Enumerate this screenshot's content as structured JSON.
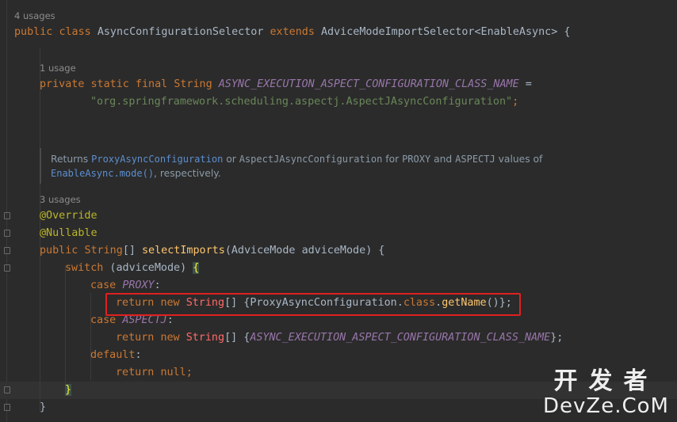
{
  "hints": {
    "usages_4": "4 usages",
    "usages_1": "1 usage",
    "usages_3": "3 usages"
  },
  "code": {
    "class_decl": {
      "public": "public",
      "class_kw": "class",
      "class_name": "AsyncConfigurationSelector",
      "extends": "extends",
      "super_name": "AdviceModeImportSelector",
      "generic_open": "<",
      "generic_type": "EnableAsync",
      "generic_close": ">",
      "brace": " {"
    },
    "field_decl": {
      "modifiers": "private static final",
      "type": "String",
      "name": "ASYNC_EXECUTION_ASPECT_CONFIGURATION_CLASS_NAME",
      "eq": " ="
    },
    "field_value": "\"org.springframework.scheduling.aspectj.AspectJAsyncConfiguration\"",
    "field_end": ";",
    "doc": {
      "line1_a": "Returns ",
      "line1_link1": "ProxyAsyncConfiguration",
      "line1_b": " or ",
      "line1_code1": "AspectJAsyncConfiguration",
      "line1_c": " for ",
      "line1_code2": "PROXY",
      "line1_d": " and ",
      "line1_code3": "ASPECTJ",
      "line1_e": " values of",
      "line2_link": "EnableAsync.mode()",
      "line2_rest": ", respectively."
    },
    "ann_override": "@Override",
    "ann_nullable": "@Nullable",
    "method_decl": {
      "public": "public",
      "ret_type": "String",
      "arr": "[] ",
      "name": "selectImports",
      "paren_open": "(",
      "param_type": "AdviceMode",
      "param_name": "adviceMode",
      "paren_close": ") {"
    },
    "switch_line": {
      "kw": "switch",
      "open": " (",
      "var": "adviceMode",
      "close": ") ",
      "brace": "{"
    },
    "case_proxy": {
      "kw": "case",
      "val": "PROXY",
      "colon": ":"
    },
    "return_proxy": {
      "ret": "return",
      "new_kw": "new",
      "type": "String",
      "arr": "[] {",
      "cls": "ProxyAsyncConfiguration",
      "dot1": ".",
      "class_kw": "class",
      "dot2": ".",
      "method": "getName",
      "end": "()};"
    },
    "case_aspectj": {
      "kw": "case",
      "val": "ASPECTJ",
      "colon": ":"
    },
    "return_aspectj": {
      "ret": "return",
      "new_kw": "new",
      "type": "String",
      "arr": "[] {",
      "const": "ASYNC_EXECUTION_ASPECT_CONFIGURATION_CLASS_NAME",
      "end": "};"
    },
    "default_line": {
      "kw": "default",
      "colon": ":"
    },
    "return_null": {
      "ret": "return",
      "null_kw": "null",
      "end": ";"
    },
    "close_switch": "}",
    "close_method": "}"
  },
  "watermark": {
    "top": "开发者",
    "bottom": "DevZe.CoM"
  },
  "colors": {
    "background": "#2b2b2b",
    "keyword": "#cc7832",
    "string": "#6a8759",
    "constant": "#9876aa",
    "annotation": "#bbb529",
    "method": "#ffc66d",
    "highlight_box": "#e02020"
  }
}
